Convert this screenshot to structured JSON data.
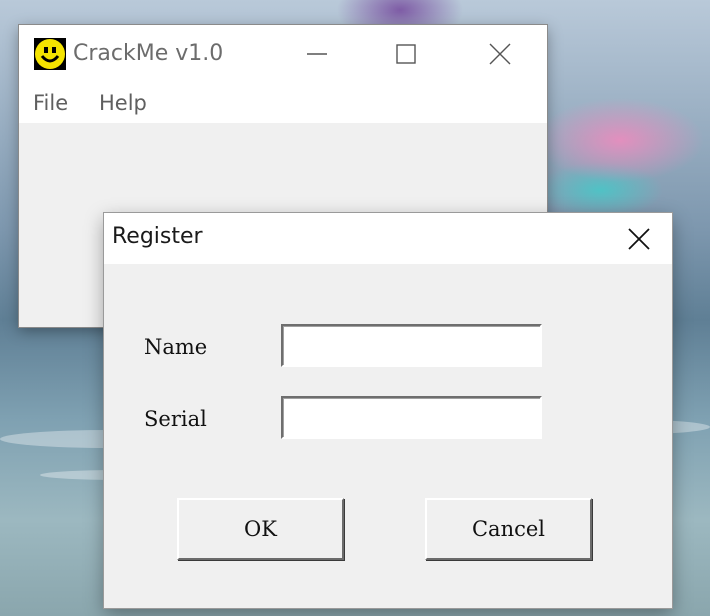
{
  "main_window": {
    "title": "CrackMe v1.0",
    "icon": "smiley-icon",
    "menu": [
      {
        "label": "File"
      },
      {
        "label": "Help"
      }
    ]
  },
  "dialog": {
    "title": "Register",
    "fields": {
      "name": {
        "label": "Name",
        "value": ""
      },
      "serial": {
        "label": "Serial",
        "value": ""
      }
    },
    "buttons": {
      "ok": "OK",
      "cancel": "Cancel"
    }
  },
  "colors": {
    "icon_yellow": "#f5e400",
    "title_gray": "#6c6c6c"
  }
}
